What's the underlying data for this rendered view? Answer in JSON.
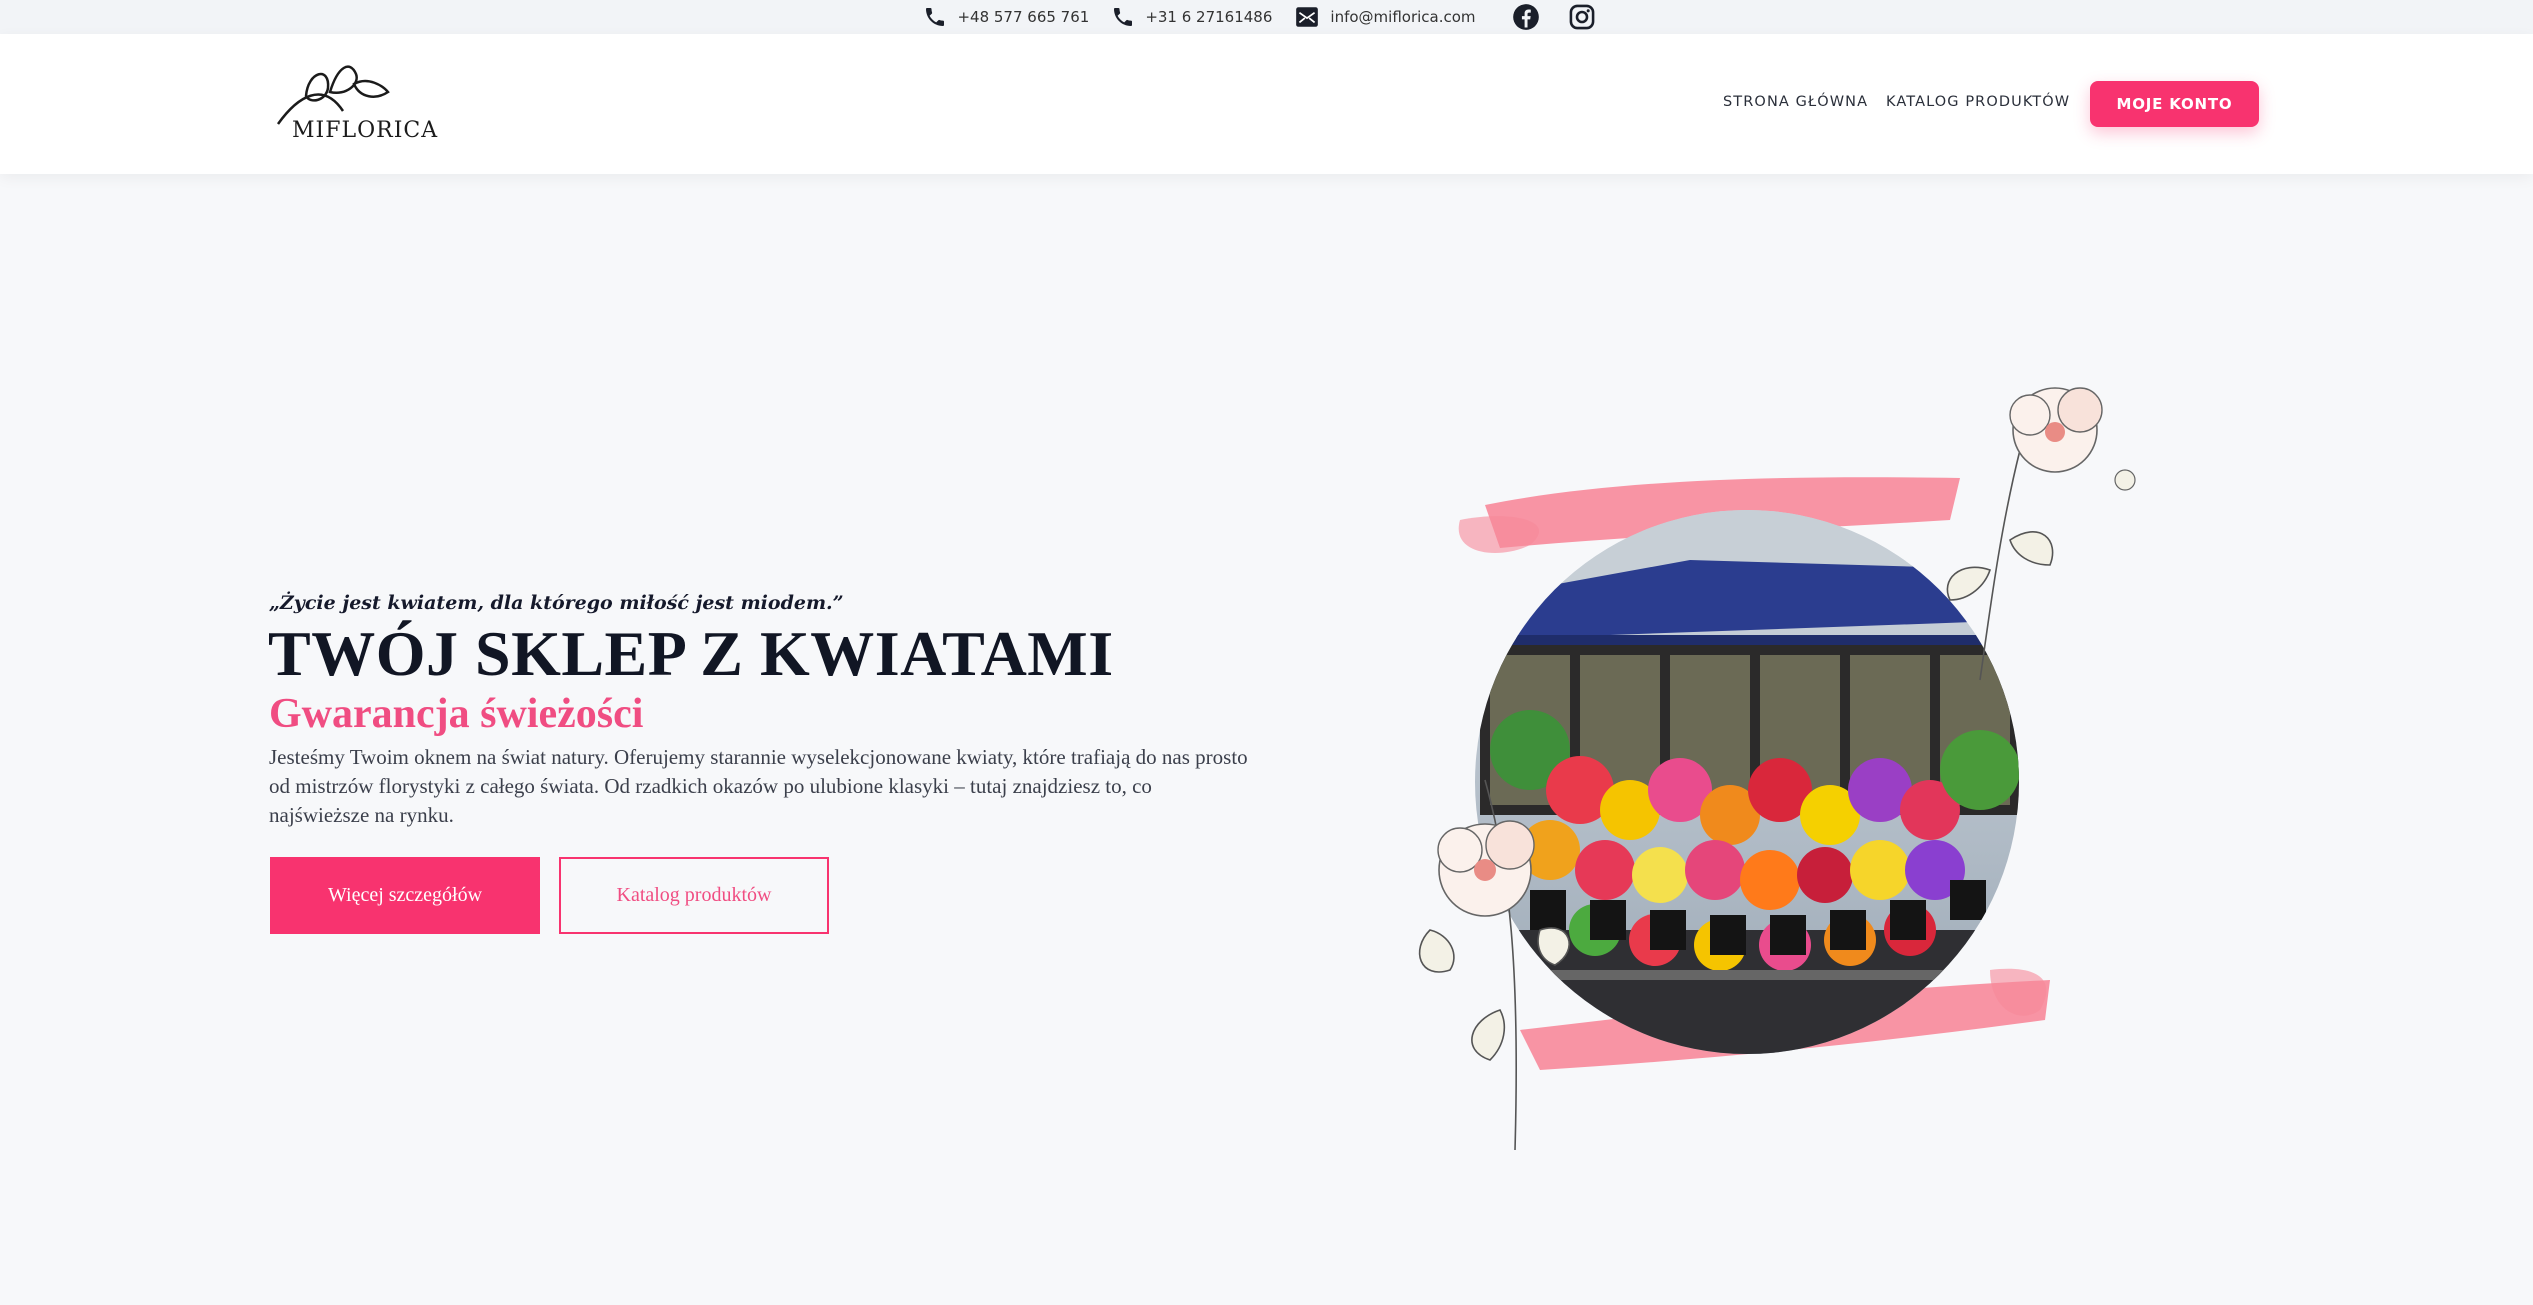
{
  "topbar": {
    "phone1": "+48 577 665 761",
    "phone2": "+31 6 27161486",
    "email": "info@miflorica.com",
    "icons": [
      "phone-icon",
      "phone-icon",
      "mail-icon",
      "facebook-icon",
      "instagram-icon"
    ]
  },
  "header": {
    "logo_text": "MIFLORICA",
    "nav": {
      "home": "STRONA GŁÓWNA",
      "catalog": "KATALOG PRODUKTÓW"
    },
    "account_button": "MOJE KONTO"
  },
  "hero": {
    "quote": "„Życie jest kwiatem, dla którego miłość jest miodem.”",
    "title": "TWÓJ SKLEP Z KWIATAMI",
    "subtitle": "Gwarancja świeżości",
    "description": "Jesteśmy Twoim oknem na świat natury. Oferujemy starannie wyselekcjonowane kwiaty, które trafiają do nas prosto od mistrzów florystyki z całego świata. Od rzadkich okazów po ulubione klasyki – tutaj znajdziesz to, co najświeższe na rynku.",
    "primary_button": "Więcej szczegółów",
    "secondary_button": "Katalog produktów"
  },
  "colors": {
    "accent": "#f8336f",
    "accent_text": "#f04d82",
    "heading": "#111624",
    "background": "#f7f8fa"
  }
}
